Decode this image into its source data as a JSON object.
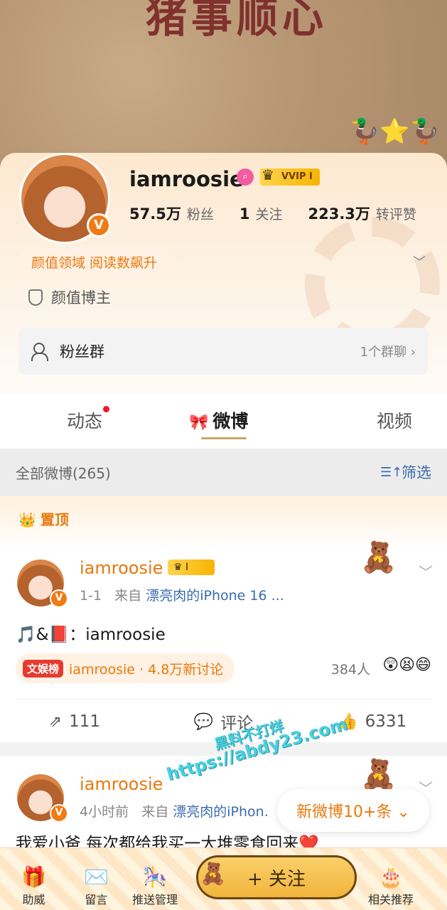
{
  "banner": {
    "title_text": "猪事顺心"
  },
  "profile": {
    "username": "iamroosie",
    "vip_label": "VVIP I",
    "stats": [
      {
        "value": "57.5万",
        "label": "粉丝"
      },
      {
        "value": "1",
        "label": "关注"
      },
      {
        "value": "223.3万",
        "label": "转评赞"
      }
    ],
    "tag_chip": "颜值领域 阅读数飙升",
    "verified_label": "颜值博主",
    "fan_group": {
      "label": "粉丝群",
      "count": "1个群聊 ›"
    }
  },
  "tabs": [
    {
      "label": "动态"
    },
    {
      "label": "微博",
      "active": true
    },
    {
      "label": "视频"
    }
  ],
  "filter": {
    "count_label": "全部微博(265)",
    "filter_label": "筛选"
  },
  "posts": [
    {
      "pinned_label": "置顶",
      "author": "iamroosie",
      "badge": "I",
      "time": "1-1",
      "source_prefix": "来自",
      "source": "漂亮肉的iPhone 16 ...",
      "text": "🎵&📕：iamroosie",
      "hot_tag_badge": "文娱榜",
      "hot_tag_text": "iamroosie · 4.8万新讨论",
      "people": "384人",
      "reactions": "😲😫😄",
      "actions": {
        "repost": "111",
        "comment": "评论",
        "like": "6331"
      }
    },
    {
      "author": "iamroosie",
      "time": "4小时前",
      "source_prefix": "来自",
      "source": "漂亮肉的iPhon.",
      "text": "我爱小爸 每次都给我买一大堆零食回来❤️"
    }
  ],
  "watermark": {
    "line1": "黑料不打烊",
    "line2": "https://abdy23.com"
  },
  "new_posts": "新微博10+条 ⌄",
  "toolbar": {
    "help": "助威",
    "message": "留言",
    "push": "推送管理",
    "follow": "+ 关注",
    "recommend": "相关推荐"
  }
}
